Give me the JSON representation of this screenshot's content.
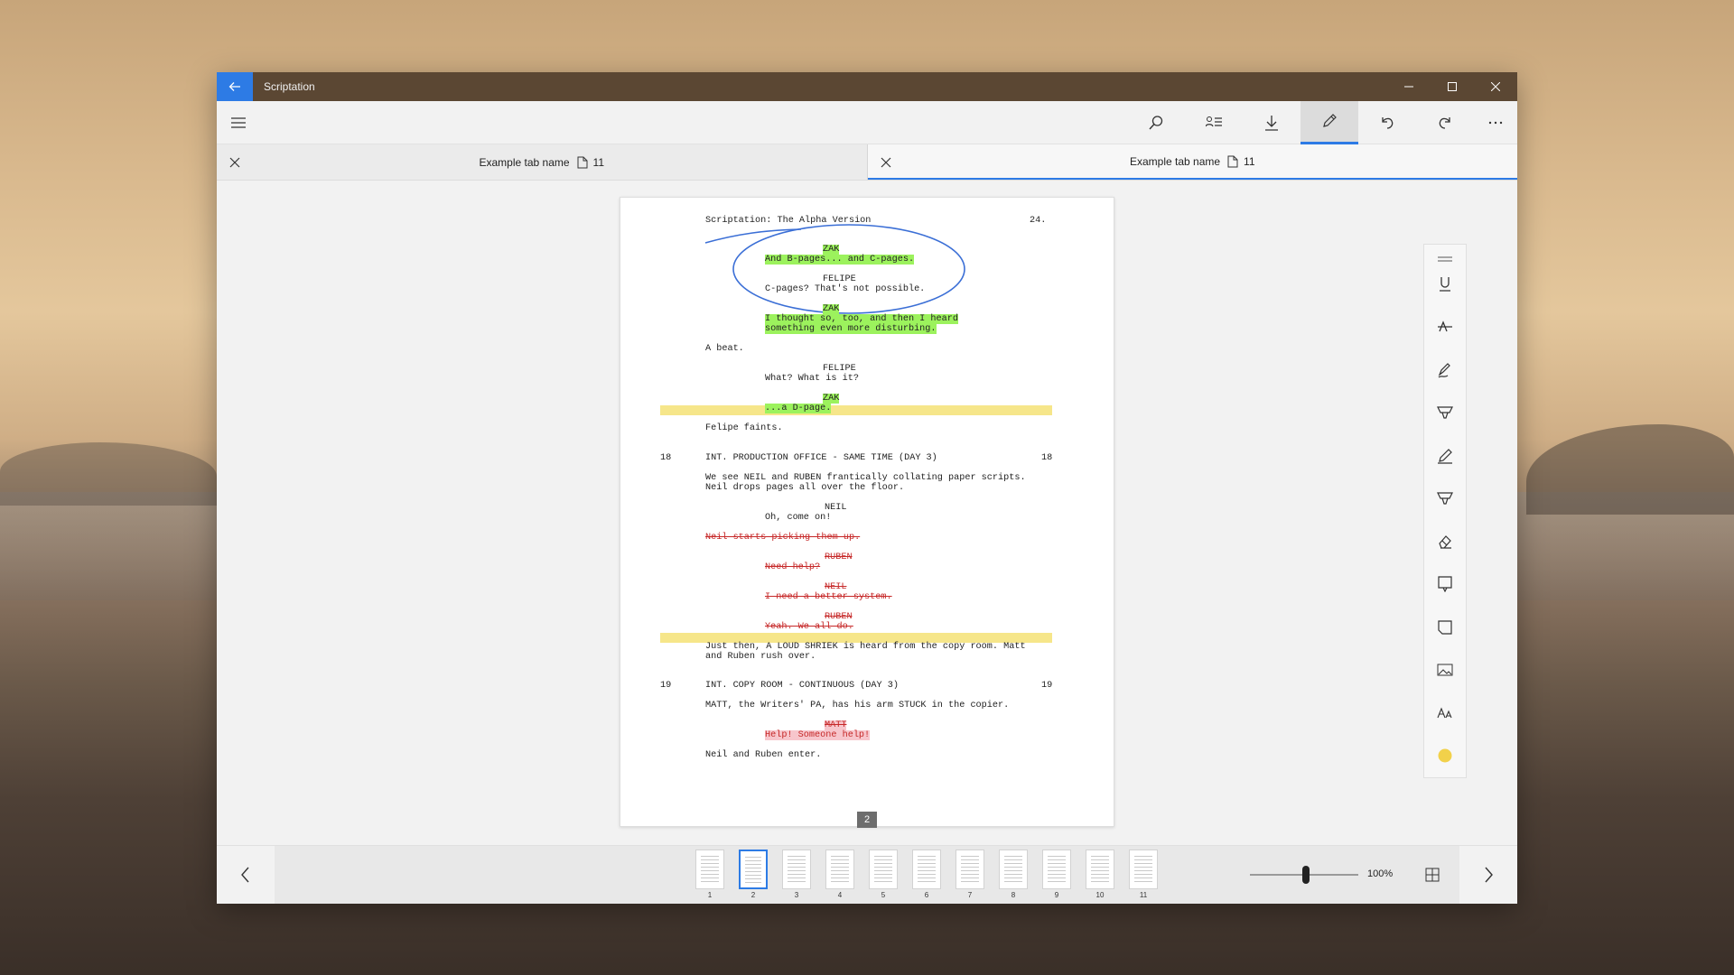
{
  "window": {
    "title": "Scriptation"
  },
  "tabs": [
    {
      "label": "Example tab name",
      "count": "11"
    },
    {
      "label": "Example tab name",
      "count": "11"
    }
  ],
  "toolbar": {
    "icons": [
      "search-icon",
      "outline-icon",
      "download-icon",
      "pen-icon",
      "undo-icon",
      "redo-icon",
      "more-icon"
    ]
  },
  "script": {
    "header_left": "Scriptation: The Alpha Version",
    "header_right": "24.",
    "zak1": "ZAK",
    "zak1_line": "And B-pages... and C-pages.",
    "felipe1": "FELIPE",
    "felipe1_line": "C-pages? That's not possible.",
    "zak2": "ZAK",
    "zak2_line1": "I thought so, too, and then I heard",
    "zak2_line2": "something even more disturbing.",
    "action1": "A beat.",
    "felipe2": "FELIPE",
    "felipe2_line": "What? What is it?",
    "zak3": "ZAK",
    "zak3_line": "...a D-page.",
    "action2": "Felipe faints.",
    "scene18_num": "18",
    "scene18_heading": "INT. PRODUCTION OFFICE - SAME TIME (DAY 3)",
    "action3_1": "We see NEIL and RUBEN frantically collating paper scripts.",
    "action3_2": "Neil drops pages all over the floor.",
    "neil1": "NEIL",
    "neil1_line": "Oh, come on!",
    "struck_action": "Neil starts picking them up.",
    "ruben1": "RUBEN",
    "ruben1_line": "Need help?",
    "neil2": "NEIL",
    "neil2_line": "I need a better system.",
    "ruben2": "RUBEN",
    "ruben2_line": "Yeah. We all do.",
    "action4_1": "Just then, A LOUD SHRIEK is heard from the copy room. Matt",
    "action4_2": "and Ruben rush over.",
    "scene19_num": "19",
    "scene19_heading": "INT. COPY ROOM - CONTINUOUS (DAY 3)",
    "action5": "MATT, the Writers' PA, has his arm STUCK in the copier.",
    "matt1": "MATT",
    "matt1_line": "Help! Someone help!",
    "action6": "Neil and Ruben enter.",
    "page_badge": "2"
  },
  "annotation_tools": [
    "underline-icon",
    "strikethrough-icon",
    "signature-icon",
    "highlighter-icon",
    "pencil-icon",
    "marker-icon",
    "eraser-icon",
    "note-icon",
    "comment-icon",
    "image-icon",
    "text-icon",
    "color-swatch"
  ],
  "colors": {
    "accent": "#2d7be5",
    "title_bar": "#5b4733",
    "highlight_green": "#9cf25d",
    "highlight_yellow": "#f6e68a",
    "swatch": "#f2d14a"
  },
  "thumbnails": {
    "pages": [
      "1",
      "2",
      "3",
      "4",
      "5",
      "6",
      "7",
      "8",
      "9",
      "10",
      "11"
    ],
    "selected": "2"
  },
  "zoom": {
    "value": "100%",
    "level": 0.5
  }
}
